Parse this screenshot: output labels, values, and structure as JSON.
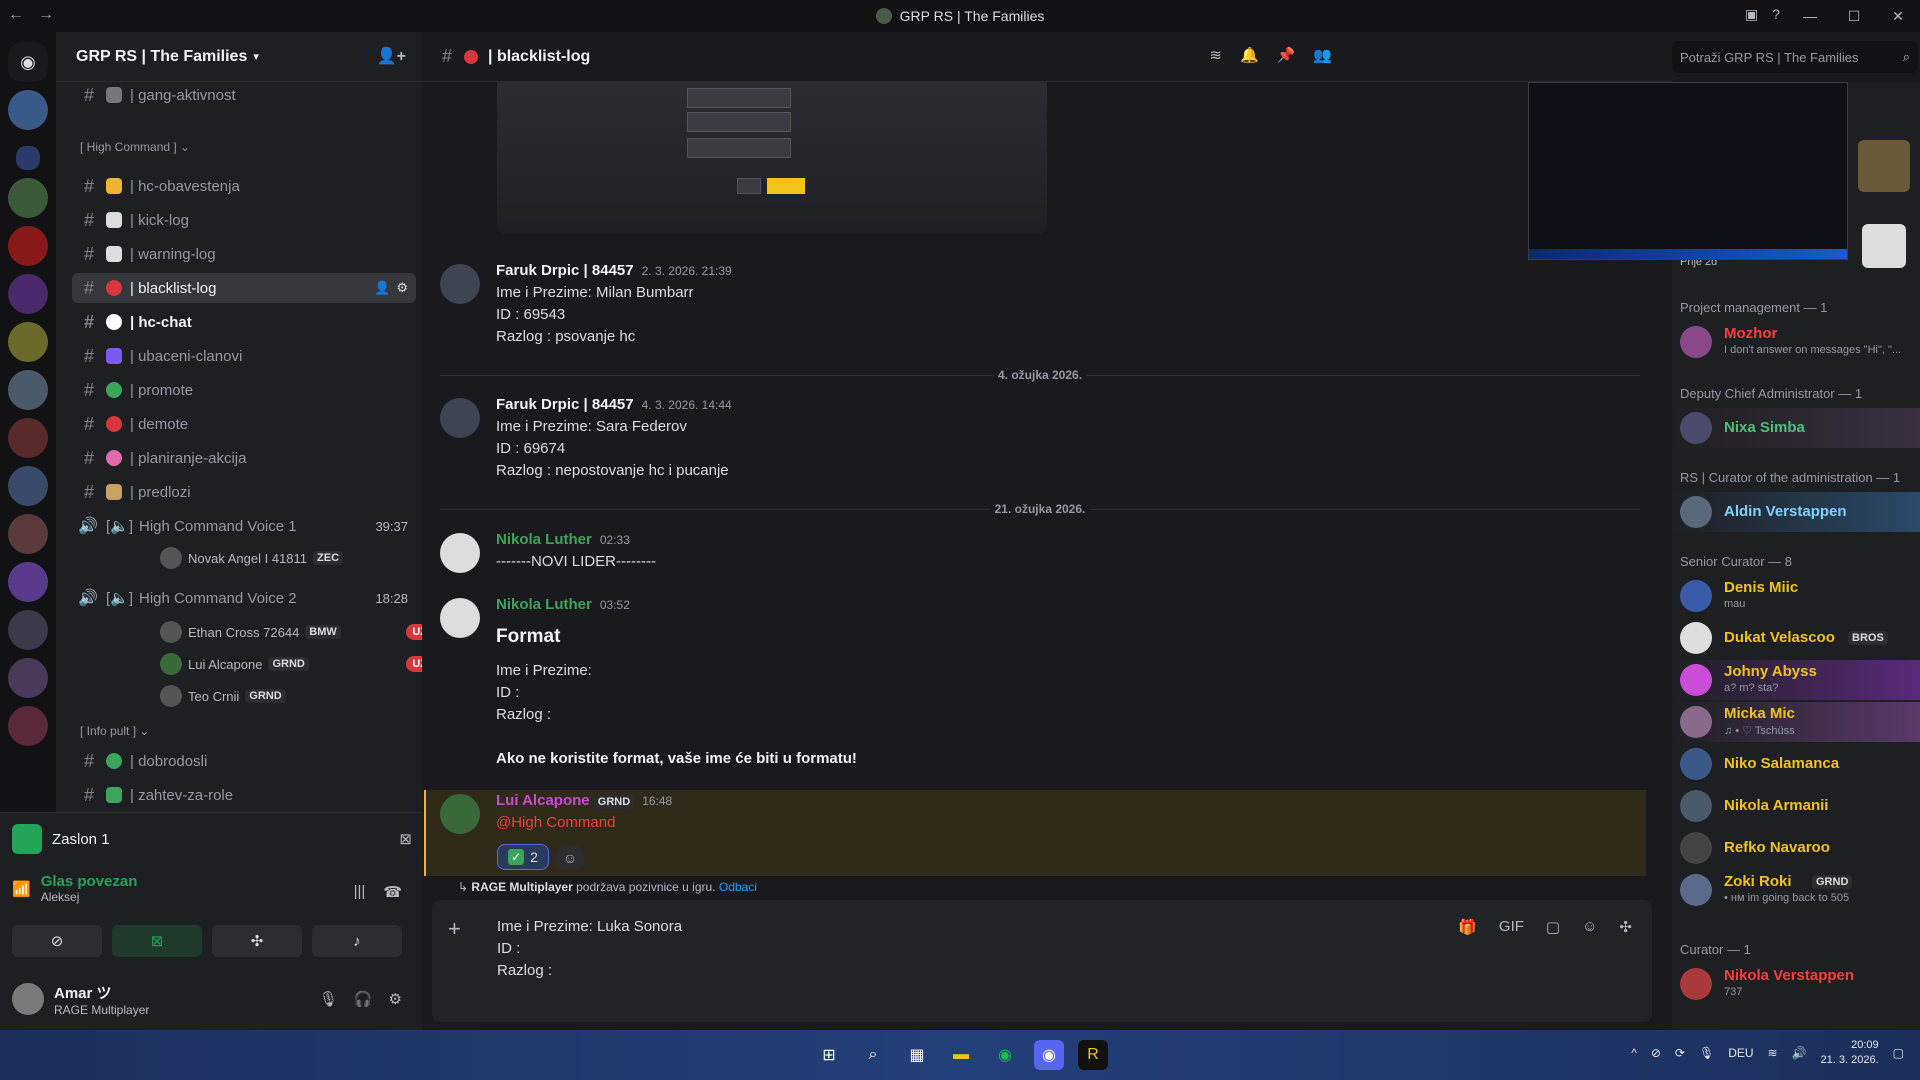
{
  "window": {
    "title": "GRP RS | The Families"
  },
  "guild": {
    "name": "GRP RS | The Families"
  },
  "channels": [
    {
      "name": "| gang-aktivnost"
    },
    {
      "name": "| hc-obavestenja"
    },
    {
      "name": "| kick-log"
    },
    {
      "name": "| warning-log"
    },
    {
      "name": "| blacklist-log"
    },
    {
      "name": "| hc-chat"
    },
    {
      "name": "| ubaceni-clanovi"
    },
    {
      "name": "| promote"
    },
    {
      "name": "| demote"
    },
    {
      "name": "| planiranje-akcija"
    },
    {
      "name": "| predlozi"
    }
  ],
  "categories": {
    "high_command": "[ High Command ]",
    "info_pult": "[ Info pult ]"
  },
  "voice": [
    {
      "name": "High Command Voice 1",
      "time": "39:37"
    },
    {
      "name": "High Command Voice 2",
      "time": "18:28"
    }
  ],
  "voice_users": [
    {
      "name": "Novak Angel I 41811",
      "tag": "ZEC"
    },
    {
      "name": "Ethan Cross 72644",
      "tag": "BMW",
      "live": "UŽIVO"
    },
    {
      "name": "Lui Alcapone",
      "tag": "GRND",
      "live": "UŽIVO"
    },
    {
      "name": "Teo Crnii",
      "tag": "GRND"
    }
  ],
  "info_channels": [
    {
      "name": "| dobrodosli"
    },
    {
      "name": "| zahtev-za-role"
    }
  ],
  "panel": {
    "screen": "Zaslon 1",
    "status": "Glas povezan",
    "status_sub": "Aleksej",
    "user": "Amar ツ",
    "user_status": "RAGE Multiplayer"
  },
  "header": {
    "channel": "| blacklist-log",
    "search_placeholder": "Potraži GRP RS | The Families"
  },
  "messages": [
    {
      "author": "Faruk Drpic | 84457",
      "time": "2. 3. 2026. 21:39",
      "lines": [
        "Ime i Prezime: Milan Bumbarr",
        "ID : 69543",
        "Razlog : psovanje hc"
      ]
    },
    {
      "author": "Faruk Drpic | 84457",
      "time": "4. 3. 2026. 14:44",
      "lines": [
        "Ime i Prezime: Sara Federov",
        "ID : 69674",
        "Razlog : nepostovanje hc i pucanje"
      ]
    },
    {
      "author": "Nikola Luther",
      "time": "02:33",
      "lines": [
        "-------NOVI LIDER--------"
      ]
    },
    {
      "author": "Nikola Luther",
      "time": "03:52",
      "heading": "Format",
      "lines": [
        "Ime i Prezime:",
        "ID :",
        "Razlog :"
      ],
      "bold_line": "Ako ne koristite format, vaše ime će biti u formatu!"
    },
    {
      "author": "Lui Alcapone",
      "tag": "GRND",
      "time": "16:48",
      "mention": "@High Command",
      "reaction_count": "2"
    }
  ],
  "dividers": [
    "4. ožujka 2026.",
    "21. ožujka 2026."
  ],
  "rage_notice": {
    "app": "RAGE Multiplayer",
    "text": "podržava pozivnice u igru.",
    "link": "Odbaci"
  },
  "composer": {
    "lines": [
      "Ime i Prezime:  Luka Sonora",
      "ID :",
      "Razlog :"
    ]
  },
  "preview_badge": "Prije 2d",
  "member_groups": [
    {
      "title": "Project management — 1",
      "members": [
        {
          "name": "Mozhor",
          "sub": "I don't answer on messages \"Hi\", \"...",
          "color": "#ff3b3b"
        }
      ]
    },
    {
      "title": "Deputy Chief Administrator — 1",
      "members": [
        {
          "name": "Nixa Simba",
          "color": "#4fbf7a"
        }
      ]
    },
    {
      "title": "RS | Curator of the administration — 1",
      "members": [
        {
          "name": "Aldin Verstappen",
          "color": "#7fd3ff"
        }
      ]
    },
    {
      "title": "Senior Curator — 8",
      "members": [
        {
          "name": "Denis Miic",
          "sub": "mau",
          "color": "#f0c419"
        },
        {
          "name": "Dukat Velascoo",
          "tag": "BROS",
          "color": "#f0c419"
        },
        {
          "name": "Johny Abyss",
          "sub": "a? m? sta?",
          "color": "#f0c419"
        },
        {
          "name": "Micka Mic",
          "sub": "♫ • ♡ Tschüss",
          "color": "#f0c419"
        },
        {
          "name": "Niko Salamanca",
          "color": "#f0c419"
        },
        {
          "name": "Nikola Armanii",
          "color": "#f0c419"
        },
        {
          "name": "Refko Navaroo",
          "color": "#f0c419"
        },
        {
          "name": "Zoki Roki",
          "tag": "GRND",
          "sub": "• нм im going back to 505",
          "color": "#f0c419"
        }
      ]
    },
    {
      "title": "Curator — 1",
      "members": [
        {
          "name": "Nikola Verstappen",
          "sub": "737",
          "color": "#ff3b3b"
        }
      ]
    }
  ],
  "tray": {
    "lang": "DEU",
    "time": "20:09",
    "date": "21. 3. 2026."
  }
}
